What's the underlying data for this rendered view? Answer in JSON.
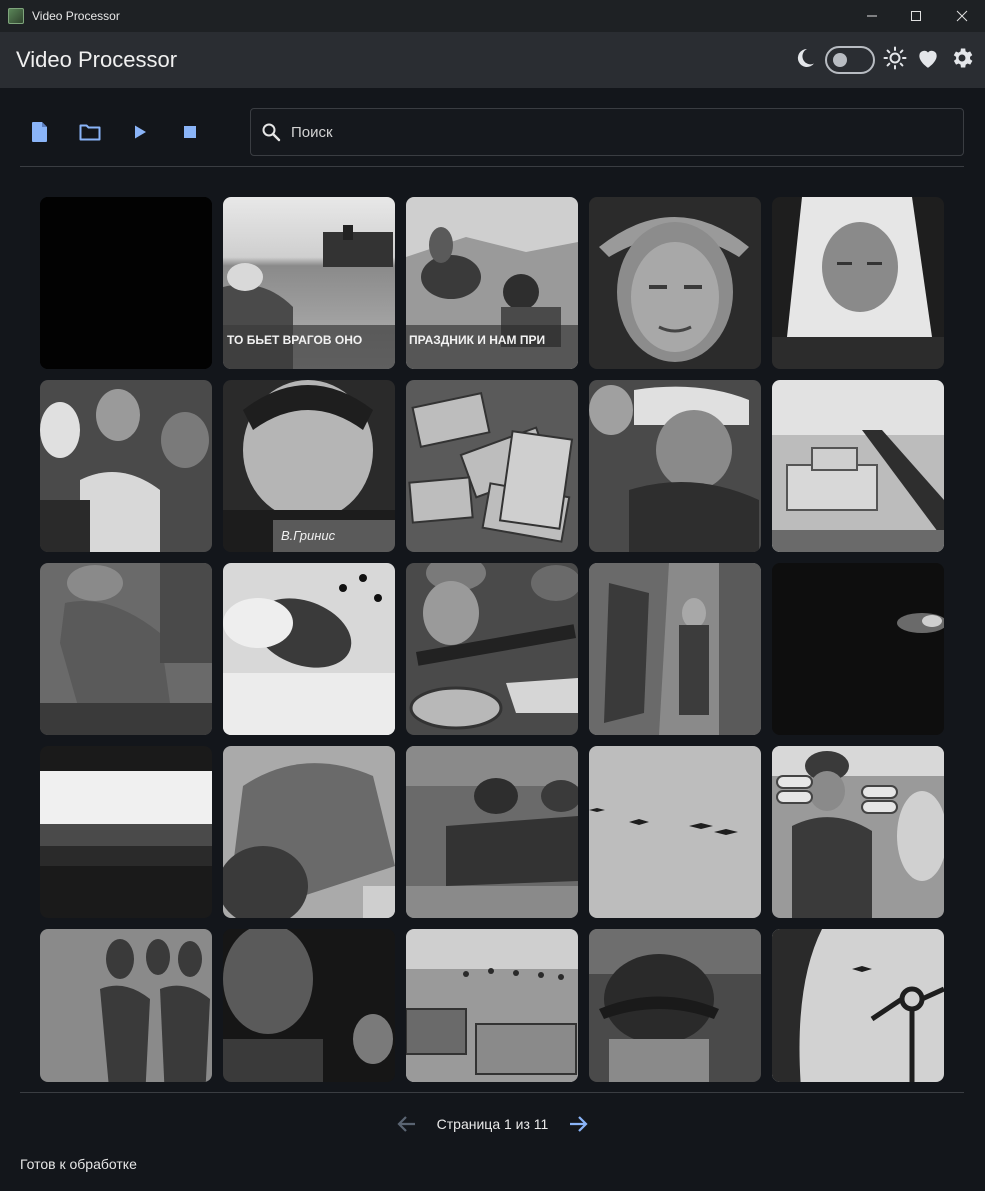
{
  "window": {
    "title": "Video Processor",
    "controls": [
      "minimize",
      "maximize",
      "close"
    ]
  },
  "header": {
    "title": "Video Processor",
    "tools": [
      {
        "name": "moon-icon"
      },
      {
        "name": "theme-toggle",
        "state": "off"
      },
      {
        "name": "sun-icon"
      },
      {
        "name": "heart-icon"
      },
      {
        "name": "gear-icon"
      }
    ]
  },
  "toolbar": {
    "buttons": [
      "file-icon",
      "folder-icon",
      "play-icon",
      "stop-icon"
    ],
    "accent": "#8ab4f8"
  },
  "search": {
    "placeholder": "Поиск",
    "value": ""
  },
  "thumbnails": [
    {
      "scene": "black"
    },
    {
      "scene": "harvest-field",
      "caption": "ТО БЬЕТ ВРАГОВ ОНО"
    },
    {
      "scene": "horse-rider",
      "caption": "ПРАЗДНИК И НАМ ПРИ"
    },
    {
      "scene": "woman-headscarf"
    },
    {
      "scene": "woman-white-scarf"
    },
    {
      "scene": "women-knitting"
    },
    {
      "scene": "girl-closeup",
      "caption": "В.Гринис"
    },
    {
      "scene": "banknotes"
    },
    {
      "scene": "elderly-fur-hat"
    },
    {
      "scene": "tank-snow"
    },
    {
      "scene": "soldier-kneeling"
    },
    {
      "scene": "wounded-soldier"
    },
    {
      "scene": "soldiers-bowl"
    },
    {
      "scene": "trench"
    },
    {
      "scene": "dark-night"
    },
    {
      "scene": "horizon-bunker"
    },
    {
      "scene": "rocks-soldier"
    },
    {
      "scene": "soldiers-trench-back"
    },
    {
      "scene": "planes-sky"
    },
    {
      "scene": "soldiers-shells"
    },
    {
      "scene": "soldiers-running"
    },
    {
      "scene": "soldier-dark-profile"
    },
    {
      "scene": "tanks-field"
    },
    {
      "scene": "helmet-closeup"
    },
    {
      "scene": "plane-window"
    }
  ],
  "pagination": {
    "text": "Страница 1 из 11",
    "prev_enabled": false,
    "next_enabled": true
  },
  "status": {
    "text": "Готов к обработке"
  },
  "colors": {
    "background": "#13161b",
    "header": "#2a2d32",
    "accent": "#8ab4f8",
    "text": "#e6e6e6"
  }
}
